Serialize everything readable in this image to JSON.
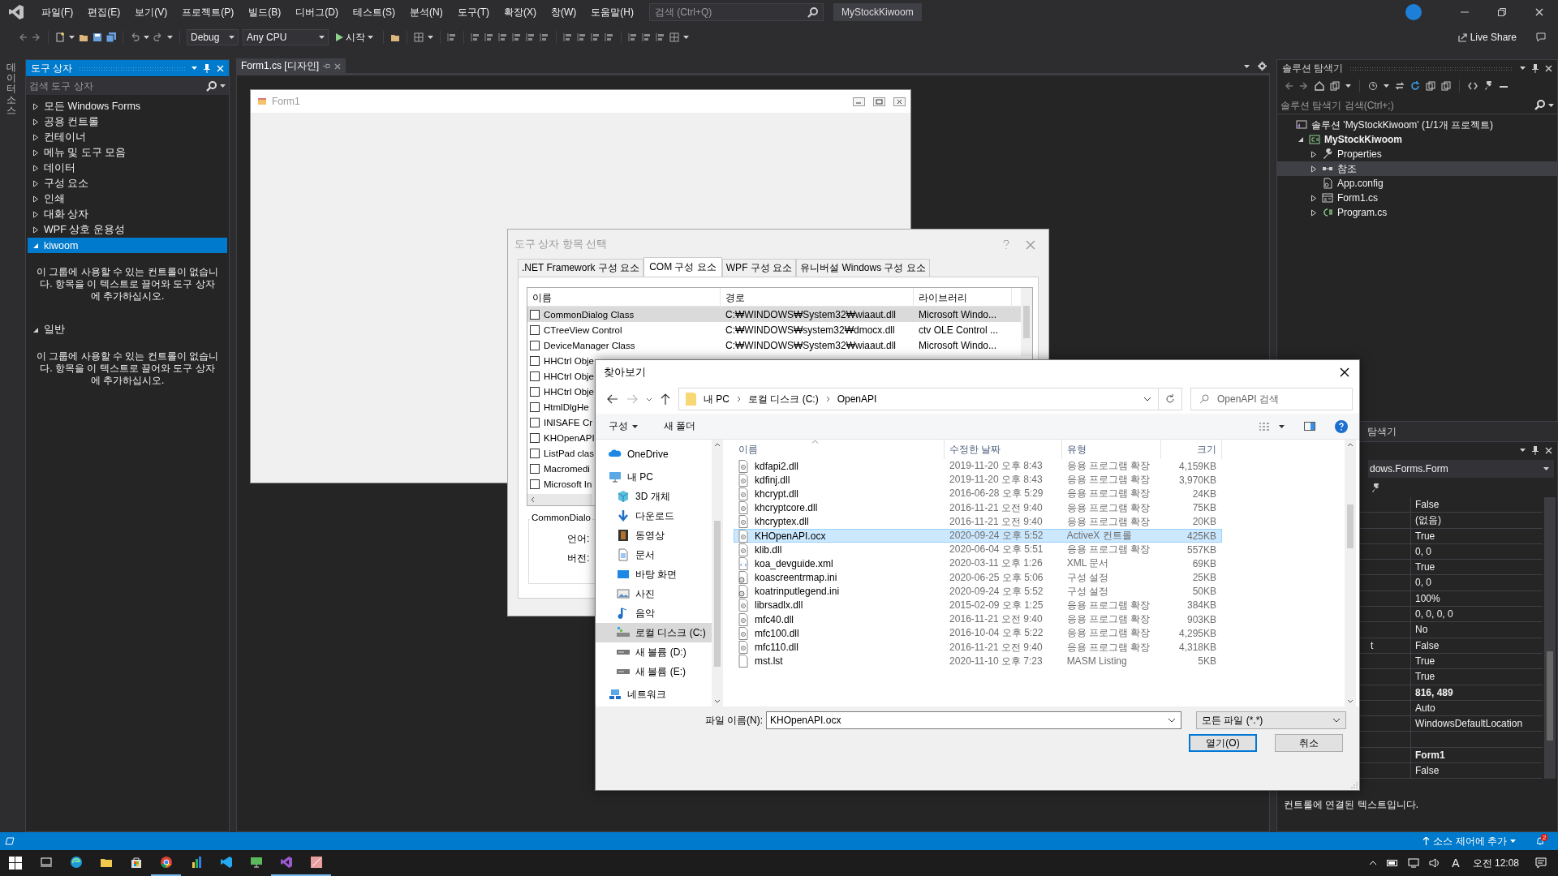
{
  "menu_bar": {
    "items": [
      "파일(F)",
      "편집(E)",
      "보기(V)",
      "프로젝트(P)",
      "빌드(B)",
      "디버그(D)",
      "테스트(S)",
      "분석(N)",
      "도구(T)",
      "확장(X)",
      "창(W)",
      "도움말(H)"
    ],
    "search": {
      "placeholder": "검색 (Ctrl+Q)"
    },
    "solution_name": "MyStockKiwoom"
  },
  "toolbar": {
    "configuration": "Debug",
    "platform": "Any CPU",
    "start": "시작",
    "live_share": "Live Share"
  },
  "side_strip": {
    "label": "데이터 소스"
  },
  "toolbox": {
    "title": "도구 상자",
    "search": {
      "placeholder": "검색 도구 상자"
    },
    "groups": [
      {
        "label": "모든 Windows Forms",
        "expanded": false,
        "selected": false
      },
      {
        "label": "공용 컨트롤",
        "expanded": false,
        "selected": false
      },
      {
        "label": "컨테이너",
        "expanded": false,
        "selected": false
      },
      {
        "label": "메뉴 및 도구 모음",
        "expanded": false,
        "selected": false
      },
      {
        "label": "데이터",
        "expanded": false,
        "selected": false
      },
      {
        "label": "구성 요소",
        "expanded": false,
        "selected": false
      },
      {
        "label": "인쇄",
        "expanded": false,
        "selected": false
      },
      {
        "label": "대화 상자",
        "expanded": false,
        "selected": false
      },
      {
        "label": "WPF 상호 운용성",
        "expanded": false,
        "selected": false
      },
      {
        "label": "kiwoom",
        "expanded": true,
        "selected": true,
        "message": "이 그룹에 사용할 수 있는 컨트롤이 없습니다. 항목을 이 텍스트로 끌어와 도구 상자에 추가하십시오."
      },
      {
        "label": "일반",
        "expanded": true,
        "selected": false,
        "message": "이 그룹에 사용할 수 있는 컨트롤이 없습니다. 항목을 이 텍스트로 끌어와 도구 상자에 추가하십시오."
      }
    ]
  },
  "editor": {
    "tabs": [
      {
        "label": "Form1.cs [디자인]",
        "selected": true
      }
    ],
    "form": {
      "title": "Form1"
    }
  },
  "solution_explorer": {
    "title": "솔루션 탐색기",
    "search": {
      "placeholder": "솔루션 탐색기 검색(Ctrl+;)"
    },
    "tree": [
      {
        "label": "솔루션 'MyStockKiwoom' (1/1개 프로젝트)",
        "kind": "solution",
        "selected": false,
        "children": [
          {
            "label": "MyStockKiwoom",
            "kind": "project",
            "expanded": true,
            "selected": false,
            "children": [
              {
                "label": "Properties",
                "kind": "properties",
                "expanded": false,
                "selected": false
              },
              {
                "label": "참조",
                "kind": "references",
                "expanded": false,
                "selected": true
              },
              {
                "label": "App.config",
                "kind": "config",
                "selected": false
              },
              {
                "label": "Form1.cs",
                "kind": "form",
                "expanded": false,
                "selected": false
              },
              {
                "label": "Program.cs",
                "kind": "csharp",
                "expanded": false,
                "selected": false
              }
            ]
          }
        ]
      }
    ]
  },
  "panel_tab": {
    "label": "탐색기"
  },
  "properties": {
    "object": "dows.Forms.Form",
    "rows": [
      {
        "value": "False",
        "bold": false
      },
      {
        "value": "(없음)",
        "bold": false
      },
      {
        "value": "True",
        "bold": false
      },
      {
        "value": "0, 0",
        "bold": false
      },
      {
        "value": "True",
        "bold": false
      },
      {
        "value": "0, 0",
        "bold": false
      },
      {
        "value": "100%",
        "bold": false
      },
      {
        "value": "0, 0, 0, 0",
        "bold": false
      },
      {
        "value": "No",
        "bold": false
      },
      {
        "name": "t",
        "value": "False",
        "bold": false
      },
      {
        "value": "True",
        "bold": false
      },
      {
        "value": "True",
        "bold": false
      },
      {
        "value": "816, 489",
        "bold": true
      },
      {
        "value": "Auto",
        "bold": false
      },
      {
        "value": "WindowsDefaultLocation",
        "bold": false
      },
      {},
      {
        "value": "Form1",
        "bold": true
      },
      {
        "value": "False",
        "bold": false
      }
    ],
    "description": "컨트롤에 연결된 텍스트입니다."
  },
  "choose_items_dialog": {
    "title": "도구 상자 항목 선택",
    "tabs": [
      {
        "label": ".NET Framework 구성 요소",
        "selected": false
      },
      {
        "label": "COM 구성 요소",
        "selected": true
      },
      {
        "label": "WPF 구성 요소",
        "selected": false
      },
      {
        "label": "유니버설 Windows 구성 요소",
        "selected": false
      }
    ],
    "columns": [
      "이름",
      "경로",
      "라이브러리"
    ],
    "rows": [
      {
        "name": "CommonDialog Class",
        "path": "C:₩WINDOWS₩System32₩wiaaut.dll",
        "library": "Microsoft Windo...",
        "checked": false,
        "selected": true
      },
      {
        "name": "CTreeView Control",
        "path": "C:₩WINDOWS₩system32₩dmocx.dll",
        "library": "ctv OLE Control ...",
        "checked": false,
        "selected": false
      },
      {
        "name": "DeviceManager Class",
        "path": "C:₩WINDOWS₩System32₩wiaaut.dll",
        "library": "Microsoft Windo...",
        "checked": false,
        "selected": false
      },
      {
        "name": "HHCtrl Obje",
        "checked": false,
        "selected": false
      },
      {
        "name": "HHCtrl Obje",
        "checked": false,
        "selected": false
      },
      {
        "name": "HHCtrl Obje",
        "checked": false,
        "selected": false
      },
      {
        "name": "HtmlDlgHe",
        "checked": false,
        "selected": false
      },
      {
        "name": "INISAFE Cr",
        "checked": false,
        "selected": false
      },
      {
        "name": "KHOpenAPI",
        "checked": false,
        "selected": false
      },
      {
        "name": "ListPad clas",
        "checked": false,
        "selected": false
      },
      {
        "name": "Macromedi",
        "checked": false,
        "selected": false
      },
      {
        "name": "Microsoft In",
        "checked": false,
        "selected": false
      }
    ],
    "details": {
      "name": "CommonDialo",
      "language_label": "언어:",
      "version_label": "버전:"
    }
  },
  "browse_dialog": {
    "title": "찾아보기",
    "path": [
      "내 PC",
      "로컬 디스크 (C:)",
      "OpenAPI"
    ],
    "search": {
      "placeholder": "OpenAPI 검색"
    },
    "organize": "구성",
    "new_folder": "새 폴더",
    "nav": [
      {
        "label": "OneDrive",
        "kind": "cloud",
        "selected": false
      },
      {
        "label": "내 PC",
        "kind": "pc",
        "selected": false,
        "children": [
          {
            "label": "3D 개체",
            "kind": "cube",
            "selected": false
          },
          {
            "label": "다운로드",
            "kind": "download",
            "selected": false
          },
          {
            "label": "동영상",
            "kind": "video",
            "selected": false
          },
          {
            "label": "문서",
            "kind": "document",
            "selected": false
          },
          {
            "label": "바탕 화면",
            "kind": "desktop",
            "selected": false
          },
          {
            "label": "사진",
            "kind": "pictures",
            "selected": false
          },
          {
            "label": "음악",
            "kind": "music",
            "selected": false
          },
          {
            "label": "로컬 디스크 (C:)",
            "kind": "system-drive",
            "selected": true
          },
          {
            "label": "새 볼륨 (D:)",
            "kind": "drive",
            "selected": false
          },
          {
            "label": "새 볼륨 (E:)",
            "kind": "drive",
            "selected": false
          }
        ]
      },
      {
        "label": "네트워크",
        "kind": "network",
        "selected": false
      }
    ],
    "columns": [
      "이름",
      "수정한 날짜",
      "유형",
      "크기"
    ],
    "files": [
      {
        "name": "kdfapi2.dll",
        "date": "2019-11-20 오후 8:43",
        "type": "응용 프로그램 확장",
        "size": "4,159KB",
        "kind": "dll",
        "selected": false
      },
      {
        "name": "kdfinj.dll",
        "date": "2019-11-20 오후 8:43",
        "type": "응용 프로그램 확장",
        "size": "3,970KB",
        "kind": "dll",
        "selected": false
      },
      {
        "name": "khcrypt.dll",
        "date": "2016-06-28 오후 5:29",
        "type": "응용 프로그램 확장",
        "size": "24KB",
        "kind": "dll",
        "selected": false
      },
      {
        "name": "khcryptcore.dll",
        "date": "2016-11-21 오전 9:40",
        "type": "응용 프로그램 확장",
        "size": "75KB",
        "kind": "dll",
        "selected": false
      },
      {
        "name": "khcryptex.dll",
        "date": "2016-11-21 오전 9:40",
        "type": "응용 프로그램 확장",
        "size": "20KB",
        "kind": "dll",
        "selected": false
      },
      {
        "name": "KHOpenAPI.ocx",
        "date": "2020-09-24 오후 5:52",
        "type": "ActiveX 컨트롤",
        "size": "425KB",
        "kind": "dll",
        "selected": true
      },
      {
        "name": "klib.dll",
        "date": "2020-06-04 오후 5:51",
        "type": "응용 프로그램 확장",
        "size": "557KB",
        "kind": "dll",
        "selected": false
      },
      {
        "name": "koa_devguide.xml",
        "date": "2020-03-11 오후 1:26",
        "type": "XML 문서",
        "size": "69KB",
        "kind": "xml",
        "selected": false
      },
      {
        "name": "koascreentrmap.ini",
        "date": "2020-06-25 오후 5:06",
        "type": "구성 설정",
        "size": "25KB",
        "kind": "ini",
        "selected": false
      },
      {
        "name": "koatrinputlegend.ini",
        "date": "2020-09-24 오후 5:52",
        "type": "구성 설정",
        "size": "50KB",
        "kind": "ini",
        "selected": false
      },
      {
        "name": "librsadlx.dll",
        "date": "2015-02-09 오후 1:25",
        "type": "응용 프로그램 확장",
        "size": "384KB",
        "kind": "dll",
        "selected": false
      },
      {
        "name": "mfc40.dll",
        "date": "2016-11-21 오전 9:40",
        "type": "응용 프로그램 확장",
        "size": "903KB",
        "kind": "dll",
        "selected": false
      },
      {
        "name": "mfc100.dll",
        "date": "2016-10-04 오후 5:22",
        "type": "응용 프로그램 확장",
        "size": "4,295KB",
        "kind": "dll",
        "selected": false
      },
      {
        "name": "mfc110.dll",
        "date": "2016-11-21 오전 9:40",
        "type": "응용 프로그램 확장",
        "size": "4,318KB",
        "kind": "dll",
        "selected": false
      },
      {
        "name": "mst.lst",
        "date": "2020-11-10 오후 7:23",
        "type": "MASM Listing",
        "size": "5KB",
        "kind": "text",
        "selected": false
      }
    ],
    "file_name_label": "파일 이름(N):",
    "file_name": "KHOpenAPI.ocx",
    "filter": "모든 파일 (*.*)",
    "open_button": "열기(O)",
    "cancel_button": "취소"
  },
  "status_bar": {
    "source_control": "소스 제어에 추가",
    "notifications": "2"
  },
  "taskbar": {
    "apps": [
      {
        "kind": "taskview",
        "active": false
      },
      {
        "kind": "edge",
        "active": false
      },
      {
        "kind": "folder",
        "active": false
      },
      {
        "kind": "store",
        "active": false
      },
      {
        "kind": "chrome",
        "active": true
      },
      {
        "kind": "chart-app",
        "active": false
      },
      {
        "kind": "code",
        "active": false
      },
      {
        "kind": "monitor-app",
        "active": false
      },
      {
        "kind": "visual-studio",
        "active": true
      },
      {
        "kind": "image-app",
        "active": true
      }
    ],
    "input_mode": "A",
    "time": "오전 12:08"
  }
}
